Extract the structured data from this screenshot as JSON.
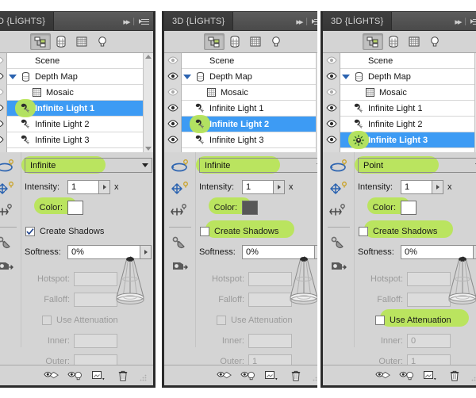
{
  "panels": [
    {
      "title": "D {LİGHTS}",
      "toolbar": {
        "buttons": [
          {
            "name": "filter-scene",
            "label": "Scene"
          },
          {
            "name": "filter-meshes",
            "label": "Meshes"
          },
          {
            "name": "filter-materials",
            "label": "Materials"
          },
          {
            "name": "filter-lights",
            "label": "Lights"
          }
        ],
        "active_index": 0
      },
      "tree": [
        {
          "label": "Scene",
          "indent": 0,
          "icon": "none",
          "twirl": false,
          "selected": false,
          "eye": "dim"
        },
        {
          "label": "Depth Map",
          "indent": 0,
          "icon": "mesh-icon",
          "twirl": true,
          "selected": false,
          "eye": "on"
        },
        {
          "label": "Mosaic",
          "indent": 1,
          "icon": "texture-icon",
          "twirl": false,
          "selected": false,
          "eye": "dim"
        },
        {
          "label": "Infinite Light 1",
          "indent": 0,
          "icon": "infinite-light-icon",
          "twirl": false,
          "selected": true,
          "eye": "on",
          "highlight_icon": true
        },
        {
          "label": "Infinite Light 2",
          "indent": 0,
          "icon": "infinite-light-icon",
          "twirl": false,
          "selected": false,
          "eye": "on"
        },
        {
          "label": "Infinite Light 3",
          "indent": 0,
          "icon": "infinite-light-icon",
          "twirl": false,
          "selected": false,
          "eye": "on"
        }
      ],
      "properties": {
        "light_type": "Infinite",
        "intensity_label": "Intensity:",
        "intensity_value": "1",
        "intensity_suffix": "x",
        "color_label": "Color:",
        "color_value": "#ffffff",
        "shadows_label": "Create Shadows",
        "shadows_checked": true,
        "softness_label": "Softness:",
        "softness_value": "0%",
        "hotspot_label": "Hotspot:",
        "hotspot_value": "",
        "falloff_label": "Falloff:",
        "falloff_value": "",
        "attenuation_label": "Use Attenuation",
        "attenuation_checked": false,
        "attenuation_enabled": false,
        "inner_label": "Inner:",
        "inner_value": "",
        "outer_label": "Outer:",
        "outer_value": ""
      },
      "highlights": [
        "type-combo",
        "color-label"
      ]
    },
    {
      "title": "3D {LİGHTS}",
      "toolbar": {
        "buttons": [
          {
            "name": "filter-scene",
            "label": "Scene"
          },
          {
            "name": "filter-meshes",
            "label": "Meshes"
          },
          {
            "name": "filter-materials",
            "label": "Materials"
          },
          {
            "name": "filter-lights",
            "label": "Lights"
          }
        ],
        "active_index": 0
      },
      "tree": [
        {
          "label": "Scene",
          "indent": 0,
          "icon": "none",
          "twirl": false,
          "selected": false,
          "eye": "dim"
        },
        {
          "label": "Depth Map",
          "indent": 0,
          "icon": "mesh-icon",
          "twirl": true,
          "selected": false,
          "eye": "on"
        },
        {
          "label": "Mosaic",
          "indent": 1,
          "icon": "texture-icon",
          "twirl": false,
          "selected": false,
          "eye": "dim"
        },
        {
          "label": "Infinite Light 1",
          "indent": 0,
          "icon": "infinite-light-icon",
          "twirl": false,
          "selected": false,
          "eye": "on"
        },
        {
          "label": "Infinite Light 2",
          "indent": 0,
          "icon": "infinite-light-icon",
          "twirl": false,
          "selected": true,
          "eye": "on",
          "highlight_icon": true
        },
        {
          "label": "Infinite Light 3",
          "indent": 0,
          "icon": "infinite-light-icon",
          "twirl": false,
          "selected": false,
          "eye": "on"
        }
      ],
      "properties": {
        "light_type": "Infinite",
        "intensity_label": "Intensity:",
        "intensity_value": "1",
        "intensity_suffix": "x",
        "color_label": "Color:",
        "color_value": "#575757",
        "shadows_label": "Create Shadows",
        "shadows_checked": false,
        "softness_label": "Softness:",
        "softness_value": "0%",
        "hotspot_label": "Hotspot:",
        "hotspot_value": "",
        "falloff_label": "Falloff:",
        "falloff_value": "",
        "attenuation_label": "Use Attenuation",
        "attenuation_checked": false,
        "attenuation_enabled": false,
        "inner_label": "Inner:",
        "inner_value": "",
        "outer_label": "Outer:",
        "outer_value": "1"
      },
      "highlights": [
        "type-combo",
        "color-label",
        "create-shadows"
      ]
    },
    {
      "title": "3D {LİGHTS}",
      "toolbar": {
        "buttons": [
          {
            "name": "filter-scene",
            "label": "Scene"
          },
          {
            "name": "filter-meshes",
            "label": "Meshes"
          },
          {
            "name": "filter-materials",
            "label": "Materials"
          },
          {
            "name": "filter-lights",
            "label": "Lights"
          }
        ],
        "active_index": 0
      },
      "tree": [
        {
          "label": "Scene",
          "indent": 0,
          "icon": "none",
          "twirl": false,
          "selected": false,
          "eye": "dim"
        },
        {
          "label": "Depth Map",
          "indent": 0,
          "icon": "mesh-icon",
          "twirl": true,
          "selected": false,
          "eye": "on"
        },
        {
          "label": "Mosaic",
          "indent": 1,
          "icon": "texture-icon",
          "twirl": false,
          "selected": false,
          "eye": "dim"
        },
        {
          "label": "Infinite Light 1",
          "indent": 0,
          "icon": "infinite-light-icon",
          "twirl": false,
          "selected": false,
          "eye": "on"
        },
        {
          "label": "Infinite Light 2",
          "indent": 0,
          "icon": "infinite-light-icon",
          "twirl": false,
          "selected": false,
          "eye": "on"
        },
        {
          "label": "Infinite Light 3",
          "indent": 0,
          "icon": "point-light-icon",
          "twirl": false,
          "selected": true,
          "eye": "on",
          "highlight_icon": true
        }
      ],
      "properties": {
        "light_type": "Point",
        "intensity_label": "Intensity:",
        "intensity_value": "1",
        "intensity_suffix": "x",
        "color_label": "Color:",
        "color_value": "#ffffff",
        "shadows_label": "Create Shadows",
        "shadows_checked": false,
        "softness_label": "Softness:",
        "softness_value": "0%",
        "hotspot_label": "Hotspot:",
        "hotspot_value": "",
        "falloff_label": "Falloff:",
        "falloff_value": "",
        "attenuation_label": "Use Attenuation",
        "attenuation_checked": false,
        "attenuation_enabled": true,
        "inner_label": "Inner:",
        "inner_value": "0",
        "outer_label": "Outer:",
        "outer_value": "1"
      },
      "highlights": [
        "type-combo",
        "color-label",
        "create-shadows",
        "use-attenuation"
      ]
    }
  ],
  "left_tools": [
    {
      "name": "rotate-light-tool"
    },
    {
      "name": "pan-light-tool"
    },
    {
      "name": "slide-light-tool"
    },
    {
      "name": "point-at-origin-tool"
    },
    {
      "name": "move-to-view-tool"
    }
  ],
  "bottom_bar": {
    "buttons": [
      {
        "name": "toggle-misc-visibility-button"
      },
      {
        "name": "toggle-lights-visibility-button"
      },
      {
        "name": "new-light-button"
      },
      {
        "name": "delete-light-button"
      }
    ]
  },
  "titlebar_controls": {
    "collapse": "▸▸",
    "separator": "|",
    "menu": "menu-icon"
  },
  "colors": {
    "selection_blue": "#3d9bf4",
    "marker_green": "#b8e558",
    "panel_gray": "#d4d4d4",
    "titlebar_dark": "#4a4a4a"
  }
}
